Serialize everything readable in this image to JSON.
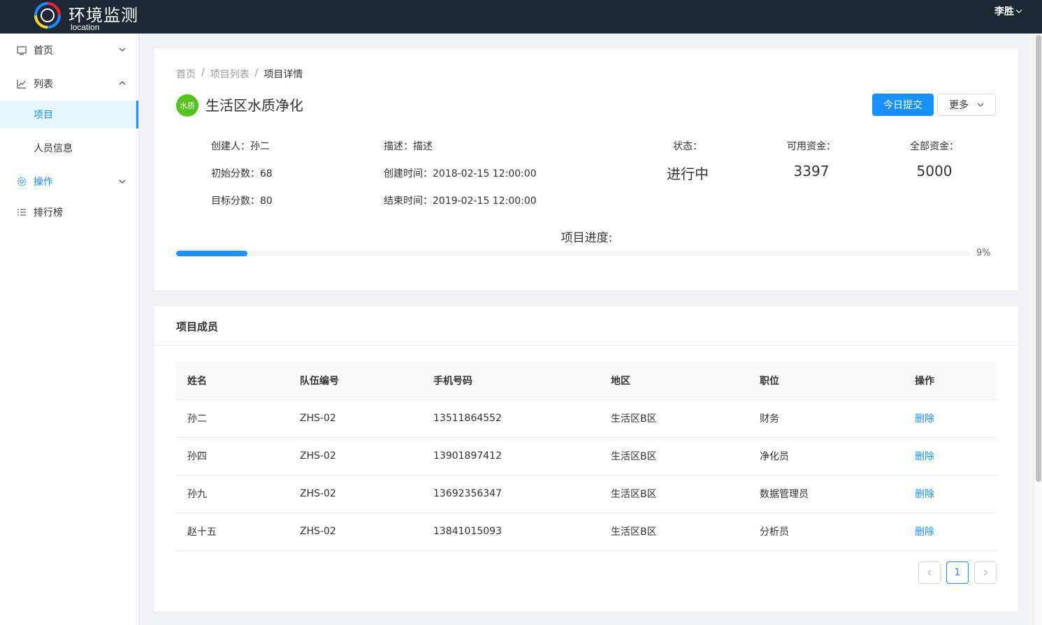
{
  "header": {
    "app_title": "环境监测",
    "app_subtitle": "location",
    "user_name": "李胜"
  },
  "sidebar": {
    "items": [
      {
        "label": "首页",
        "icon": "monitor-icon",
        "expandable": true,
        "expanded": false
      },
      {
        "label": "列表",
        "icon": "line-chart-icon",
        "expandable": true,
        "expanded": true,
        "children": [
          {
            "label": "项目",
            "selected": true
          },
          {
            "label": "人员信息",
            "selected": false
          }
        ]
      },
      {
        "label": "操作",
        "icon": "gear-icon",
        "expandable": true,
        "expanded": false,
        "active": true
      },
      {
        "label": "排行榜",
        "icon": "list-icon",
        "expandable": false
      }
    ]
  },
  "breadcrumb": [
    "首页",
    "项目列表",
    "项目详情"
  ],
  "project": {
    "avatar_text": "水质",
    "avatar_color": "#52c41a",
    "title": "生活区水质净化",
    "submit_button": "今日提交",
    "more_button": "更多",
    "creator": "创建人：孙二",
    "initial_score": "初始分数：68",
    "target_score": "目标分数：80",
    "description": "描述：描述",
    "created_time": "创建时间：2018-02-15 12:00:00",
    "end_time": "结束时间：2019-02-15 12:00:00",
    "status_label": "状态：",
    "status_value": "进行中",
    "available_funds_label": "可用资金：",
    "available_funds_value": "3397",
    "total_funds_label": "全部资金：",
    "total_funds_value": "5000",
    "progress_title": "项目进度:",
    "progress_percent": 9,
    "progress_text": "9%"
  },
  "members": {
    "title": "项目成员",
    "columns": [
      "姓名",
      "队伍编号",
      "手机号码",
      "地区",
      "职位",
      "操作"
    ],
    "rows": [
      [
        "孙二",
        "ZHS-02",
        "13511864552",
        "生活区B区",
        "财务",
        "删除"
      ],
      [
        "孙四",
        "ZHS-02",
        "13901897412",
        "生活区B区",
        "净化员",
        "删除"
      ],
      [
        "孙九",
        "ZHS-02",
        "13692356347",
        "生活区B区",
        "数据管理员",
        "删除"
      ],
      [
        "赵十五",
        "ZHS-02",
        "13841015093",
        "生活区B区",
        "分析员",
        "删除"
      ]
    ],
    "pagination": {
      "current_page": "1"
    }
  },
  "colors": {
    "header_bg": "#1d2736",
    "accent": "#1890ff",
    "avatar_green": "#52c41a"
  }
}
